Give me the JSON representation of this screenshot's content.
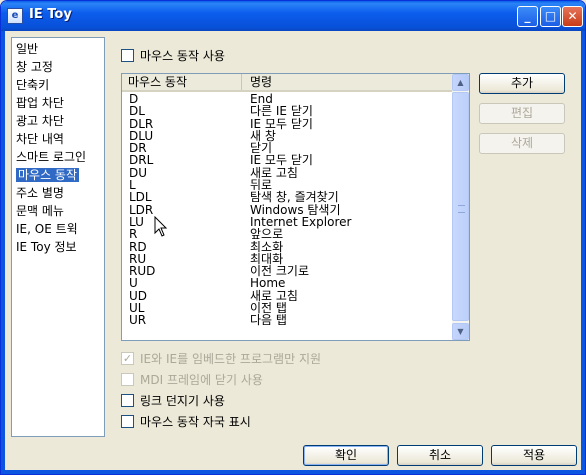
{
  "window": {
    "title": "IE Toy"
  },
  "titlebar_buttons": {
    "minimize": "_",
    "maximize": "□",
    "close": "✕"
  },
  "nav": {
    "items": [
      {
        "label": "일반",
        "selected": false
      },
      {
        "label": "창 고정",
        "selected": false
      },
      {
        "label": "단축키",
        "selected": false
      },
      {
        "label": "팝업 차단",
        "selected": false
      },
      {
        "label": "광고 차단",
        "selected": false
      },
      {
        "label": "차단 내역",
        "selected": false
      },
      {
        "label": "스마트 로그인",
        "selected": false
      },
      {
        "label": "마우스 동작",
        "selected": true
      },
      {
        "label": "주소 별명",
        "selected": false
      },
      {
        "label": "문맥 메뉴",
        "selected": false
      },
      {
        "label": "IE, OE 트윅",
        "selected": false
      },
      {
        "label": "IE Toy 정보",
        "selected": false
      }
    ]
  },
  "options": {
    "use_mouse_gesture": {
      "label": "마우스 동작 사용",
      "checked": false
    },
    "ie_embedded_only": {
      "label": "IE와 IE를 임베드한 프로그램만 지원",
      "checked": true,
      "disabled": true
    },
    "mdi_close": {
      "label": "MDI 프레임에 닫기 사용",
      "checked": false,
      "disabled": true
    },
    "link_throw": {
      "label": "링크 던지기 사용",
      "checked": false
    },
    "show_trail": {
      "label": "마우스 동작 자국 표시",
      "checked": false
    }
  },
  "gestures": {
    "columns": [
      "마우스 동작",
      "명령"
    ],
    "rows": [
      [
        "D",
        "End"
      ],
      [
        "DL",
        "다른 IE 닫기"
      ],
      [
        "DLR",
        "IE 모두 닫기"
      ],
      [
        "DLU",
        "새 창"
      ],
      [
        "DR",
        "닫기"
      ],
      [
        "DRL",
        "IE 모두 닫기"
      ],
      [
        "DU",
        "새로 고침"
      ],
      [
        "L",
        "뒤로"
      ],
      [
        "LDL",
        "탐색 창, 즐겨찾기"
      ],
      [
        "LDR",
        "Windows 탐색기"
      ],
      [
        "LU",
        "Internet Explorer"
      ],
      [
        "R",
        "앞으로"
      ],
      [
        "RD",
        "최소화"
      ],
      [
        "RU",
        "최대화"
      ],
      [
        "RUD",
        "이전 크기로"
      ],
      [
        "U",
        "Home"
      ],
      [
        "UD",
        "새로 고침"
      ],
      [
        "UL",
        "이전 탭"
      ],
      [
        "UR",
        "다음 탭"
      ]
    ]
  },
  "side_buttons": {
    "add": "추가",
    "edit": "편집",
    "delete": "삭제"
  },
  "scrollbar": {
    "up": "▲",
    "down": "▼"
  },
  "footer": {
    "ok": "확인",
    "cancel": "취소",
    "apply": "적용"
  }
}
